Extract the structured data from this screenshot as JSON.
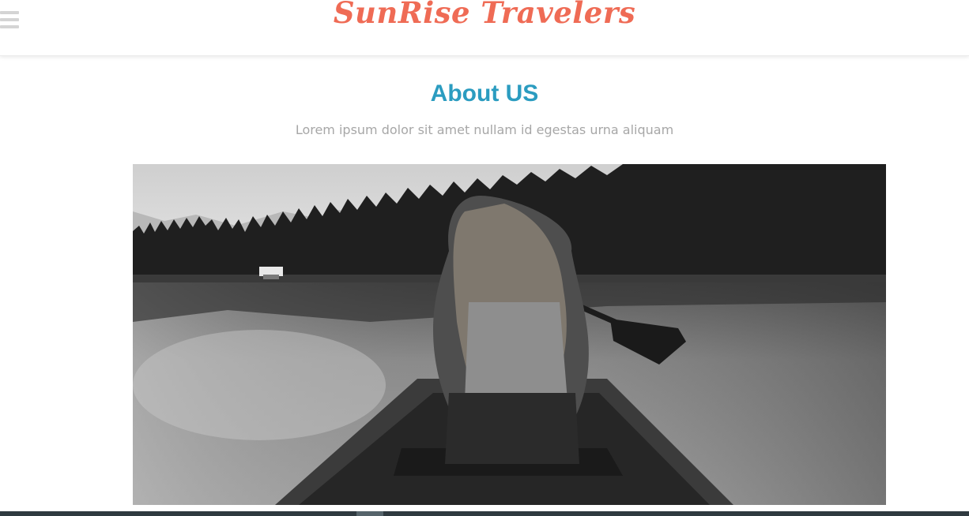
{
  "header": {
    "brand": "SunRise Travelers",
    "menu_icon": "hamburger-menu-icon",
    "brand_color": "#ef6b55"
  },
  "about": {
    "title": "About US",
    "subtitle": "Lorem ipsum dolor sit amet nullam id egestas urna aliquam",
    "title_color": "#2b9cc0"
  },
  "photo": {
    "alt": "Woman paddling a canoe on a lake"
  }
}
